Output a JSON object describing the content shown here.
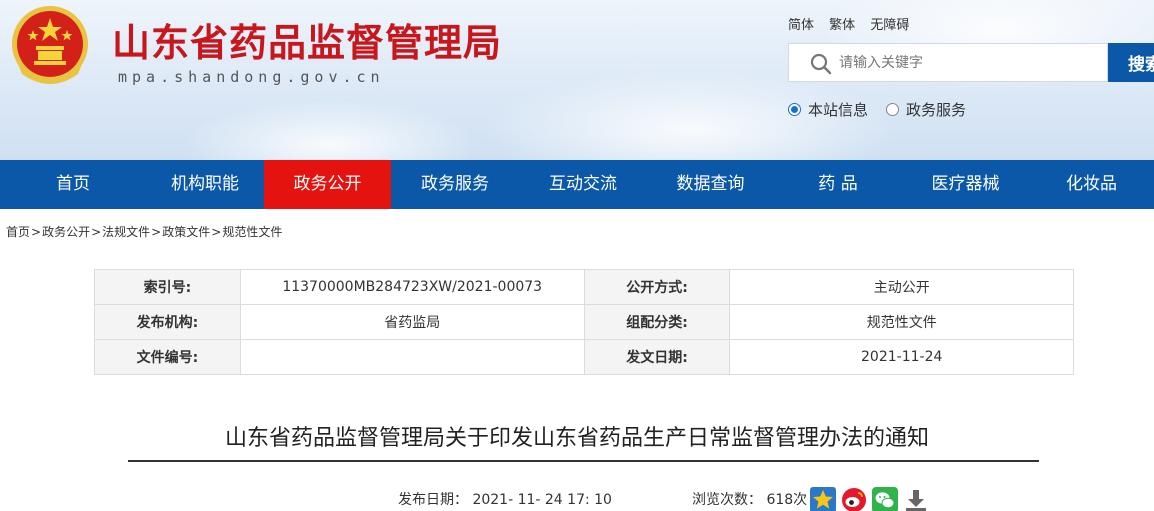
{
  "header": {
    "title": "山东省药品监督管理局",
    "domain": "mpa.shandong.gov.cn",
    "lang_links": [
      "简体",
      "繁体",
      "无障碍"
    ],
    "search": {
      "placeholder": "请输入关键字",
      "button_label": "搜索"
    },
    "scope_options": [
      {
        "label": "本站信息",
        "selected": true
      },
      {
        "label": "政务服务",
        "selected": false
      }
    ]
  },
  "nav": {
    "items": [
      {
        "label": "首页",
        "active": false
      },
      {
        "label": "机构职能",
        "active": false
      },
      {
        "label": "政务公开",
        "active": true
      },
      {
        "label": "政务服务",
        "active": false
      },
      {
        "label": "互动交流",
        "active": false
      },
      {
        "label": "数据查询",
        "active": false
      },
      {
        "label": "药 品",
        "active": false
      },
      {
        "label": "医疗器械",
        "active": false
      },
      {
        "label": "化妆品",
        "active": false
      }
    ]
  },
  "breadcrumb": [
    "首页",
    "政务公开",
    "法规文件",
    "政策文件",
    "规范性文件"
  ],
  "info": {
    "rows": [
      {
        "k1": "索引号:",
        "v1": "11370000MB284723XW/2021-00073",
        "k2": "公开方式:",
        "v2": "主动公开"
      },
      {
        "k1": "发布机构:",
        "v1": "省药监局",
        "k2": "组配分类:",
        "v2": "规范性文件"
      },
      {
        "k1": "文件编号:",
        "v1": "",
        "k2": "发文日期:",
        "v2": "2021-11-24"
      }
    ]
  },
  "article": {
    "title": "山东省药品监督管理局关于印发山东省药品生产日常监督管理办法的通知",
    "publish_date": "发布日期： 2021- 11- 24 17: 10",
    "views": "浏览次数： 618次"
  },
  "colors": {
    "brand_blue": "#0b58a8",
    "active_red": "#e4130f",
    "title_red": "#c8161d"
  },
  "icons": [
    "national-emblem-icon",
    "search-icon",
    "favorite-star-icon",
    "weibo-icon",
    "wechat-icon",
    "download-icon"
  ]
}
